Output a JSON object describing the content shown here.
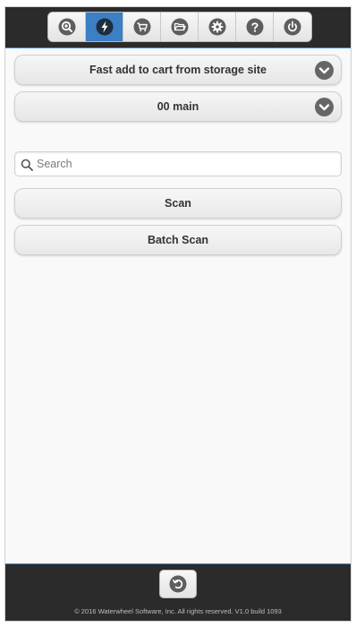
{
  "nav": {
    "items": [
      {
        "icon": "search-zoom-icon",
        "active": false
      },
      {
        "icon": "lightning-icon",
        "active": true
      },
      {
        "icon": "cart-icon",
        "active": false
      },
      {
        "icon": "folder-icon",
        "active": false
      },
      {
        "icon": "gear-icon",
        "active": false
      },
      {
        "icon": "help-icon",
        "active": false
      },
      {
        "icon": "power-icon",
        "active": false
      }
    ]
  },
  "selects": {
    "mode": "Fast add to cart from storage site",
    "site": "00 main"
  },
  "search": {
    "placeholder": "Search",
    "value": ""
  },
  "buttons": {
    "scan": "Scan",
    "batch_scan": "Batch Scan"
  },
  "footer": {
    "back_icon": "undo-icon",
    "copyright": "© 2016 Waterwheel Software, Inc. All rights reserved. V1.0 build 1093"
  },
  "colors": {
    "header_bg": "#2b2b2b",
    "accent": "#3b7fc4",
    "icon_dark": "#5e5e5e"
  }
}
